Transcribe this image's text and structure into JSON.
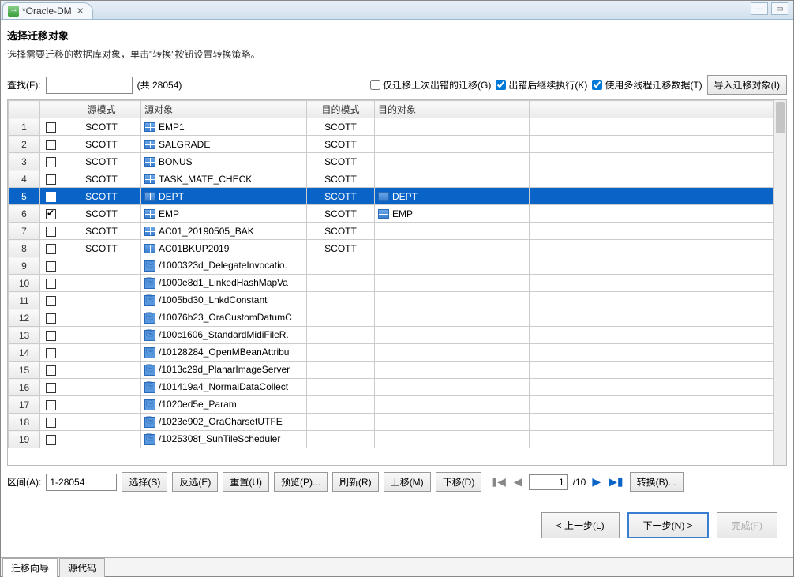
{
  "window": {
    "title": "*Oracle-DM"
  },
  "header": {
    "title": "选择迁移对象",
    "description": "选择需要迁移的数据库对象，单击\"转换\"按钮设置转换策略。"
  },
  "find": {
    "label": "查找(F):",
    "value": "",
    "count_text": "(共 28054)"
  },
  "options": {
    "only_err": {
      "label": "仅迁移上次出错的迁移(G)",
      "checked": false
    },
    "continue_err": {
      "label": "出错后继续执行(K)",
      "checked": true
    },
    "multithread": {
      "label": "使用多线程迁移数据(T)",
      "checked": true
    }
  },
  "import_btn": "导入迁移对象(I)",
  "columns": {
    "src_schema": "源模式",
    "src_obj": "源对象",
    "tgt_schema": "目的模式",
    "tgt_obj": "目的对象"
  },
  "rows": [
    {
      "n": "1",
      "chk": false,
      "ss": "SCOTT",
      "so": "EMP1",
      "ico": "table",
      "ts": "SCOTT",
      "to": ""
    },
    {
      "n": "2",
      "chk": false,
      "ss": "SCOTT",
      "so": "SALGRADE",
      "ico": "table",
      "ts": "SCOTT",
      "to": ""
    },
    {
      "n": "3",
      "chk": false,
      "ss": "SCOTT",
      "so": "BONUS",
      "ico": "table",
      "ts": "SCOTT",
      "to": ""
    },
    {
      "n": "4",
      "chk": false,
      "ss": "SCOTT",
      "so": "TASK_MATE_CHECK",
      "ico": "table",
      "ts": "SCOTT",
      "to": ""
    },
    {
      "n": "5",
      "chk": true,
      "ss": "SCOTT",
      "so": "DEPT",
      "ico": "table",
      "ts": "SCOTT",
      "to": "DEPT",
      "toico": "table",
      "selected": true
    },
    {
      "n": "6",
      "chk": true,
      "ss": "SCOTT",
      "so": "EMP",
      "ico": "table",
      "ts": "SCOTT",
      "to": "EMP",
      "toico": "table"
    },
    {
      "n": "7",
      "chk": false,
      "ss": "SCOTT",
      "so": "AC01_20190505_BAK",
      "ico": "table",
      "ts": "SCOTT",
      "to": ""
    },
    {
      "n": "8",
      "chk": false,
      "ss": "SCOTT",
      "so": "AC01BKUP2019",
      "ico": "table",
      "ts": "SCOTT",
      "to": ""
    },
    {
      "n": "9",
      "chk": false,
      "ss": "",
      "so": "/1000323d_DelegateInvocatio.",
      "ico": "db",
      "ts": "",
      "to": ""
    },
    {
      "n": "10",
      "chk": false,
      "ss": "",
      "so": "/1000e8d1_LinkedHashMapVa",
      "ico": "db",
      "ts": "",
      "to": ""
    },
    {
      "n": "11",
      "chk": false,
      "ss": "",
      "so": "/1005bd30_LnkdConstant",
      "ico": "db",
      "ts": "",
      "to": ""
    },
    {
      "n": "12",
      "chk": false,
      "ss": "",
      "so": "/10076b23_OraCustomDatumC",
      "ico": "db",
      "ts": "",
      "to": ""
    },
    {
      "n": "13",
      "chk": false,
      "ss": "",
      "so": "/100c1606_StandardMidiFileR.",
      "ico": "db",
      "ts": "",
      "to": ""
    },
    {
      "n": "14",
      "chk": false,
      "ss": "",
      "so": "/10128284_OpenMBeanAttribu",
      "ico": "db",
      "ts": "",
      "to": ""
    },
    {
      "n": "15",
      "chk": false,
      "ss": "",
      "so": "/1013c29d_PlanarImageServer",
      "ico": "db",
      "ts": "",
      "to": ""
    },
    {
      "n": "16",
      "chk": false,
      "ss": "",
      "so": "/101419a4_NormalDataCollect",
      "ico": "db",
      "ts": "",
      "to": ""
    },
    {
      "n": "17",
      "chk": false,
      "ss": "",
      "so": "/1020ed5e_Param",
      "ico": "db",
      "ts": "",
      "to": ""
    },
    {
      "n": "18",
      "chk": false,
      "ss": "",
      "so": "/1023e902_OraCharsetUTFE",
      "ico": "db",
      "ts": "",
      "to": ""
    },
    {
      "n": "19",
      "chk": false,
      "ss": "",
      "so": "/1025308f_SunTileScheduler",
      "ico": "db",
      "ts": "",
      "to": ""
    }
  ],
  "range": {
    "label": "区间(A):",
    "value": "1-28054"
  },
  "buttons": {
    "select": "选择(S)",
    "deselect": "反选(E)",
    "reset": "重置(U)",
    "preview": "预览(P)...",
    "refresh": "刷新(R)",
    "moveup": "上移(M)",
    "movedown": "下移(D)",
    "convert": "转换(B)..."
  },
  "pager": {
    "page": "1",
    "total": "/10"
  },
  "nav": {
    "back": "< 上一步(L)",
    "next": "下一步(N) >",
    "finish": "完成(F)"
  },
  "tabs": {
    "wizard": "迁移向导",
    "source": "源代码"
  }
}
